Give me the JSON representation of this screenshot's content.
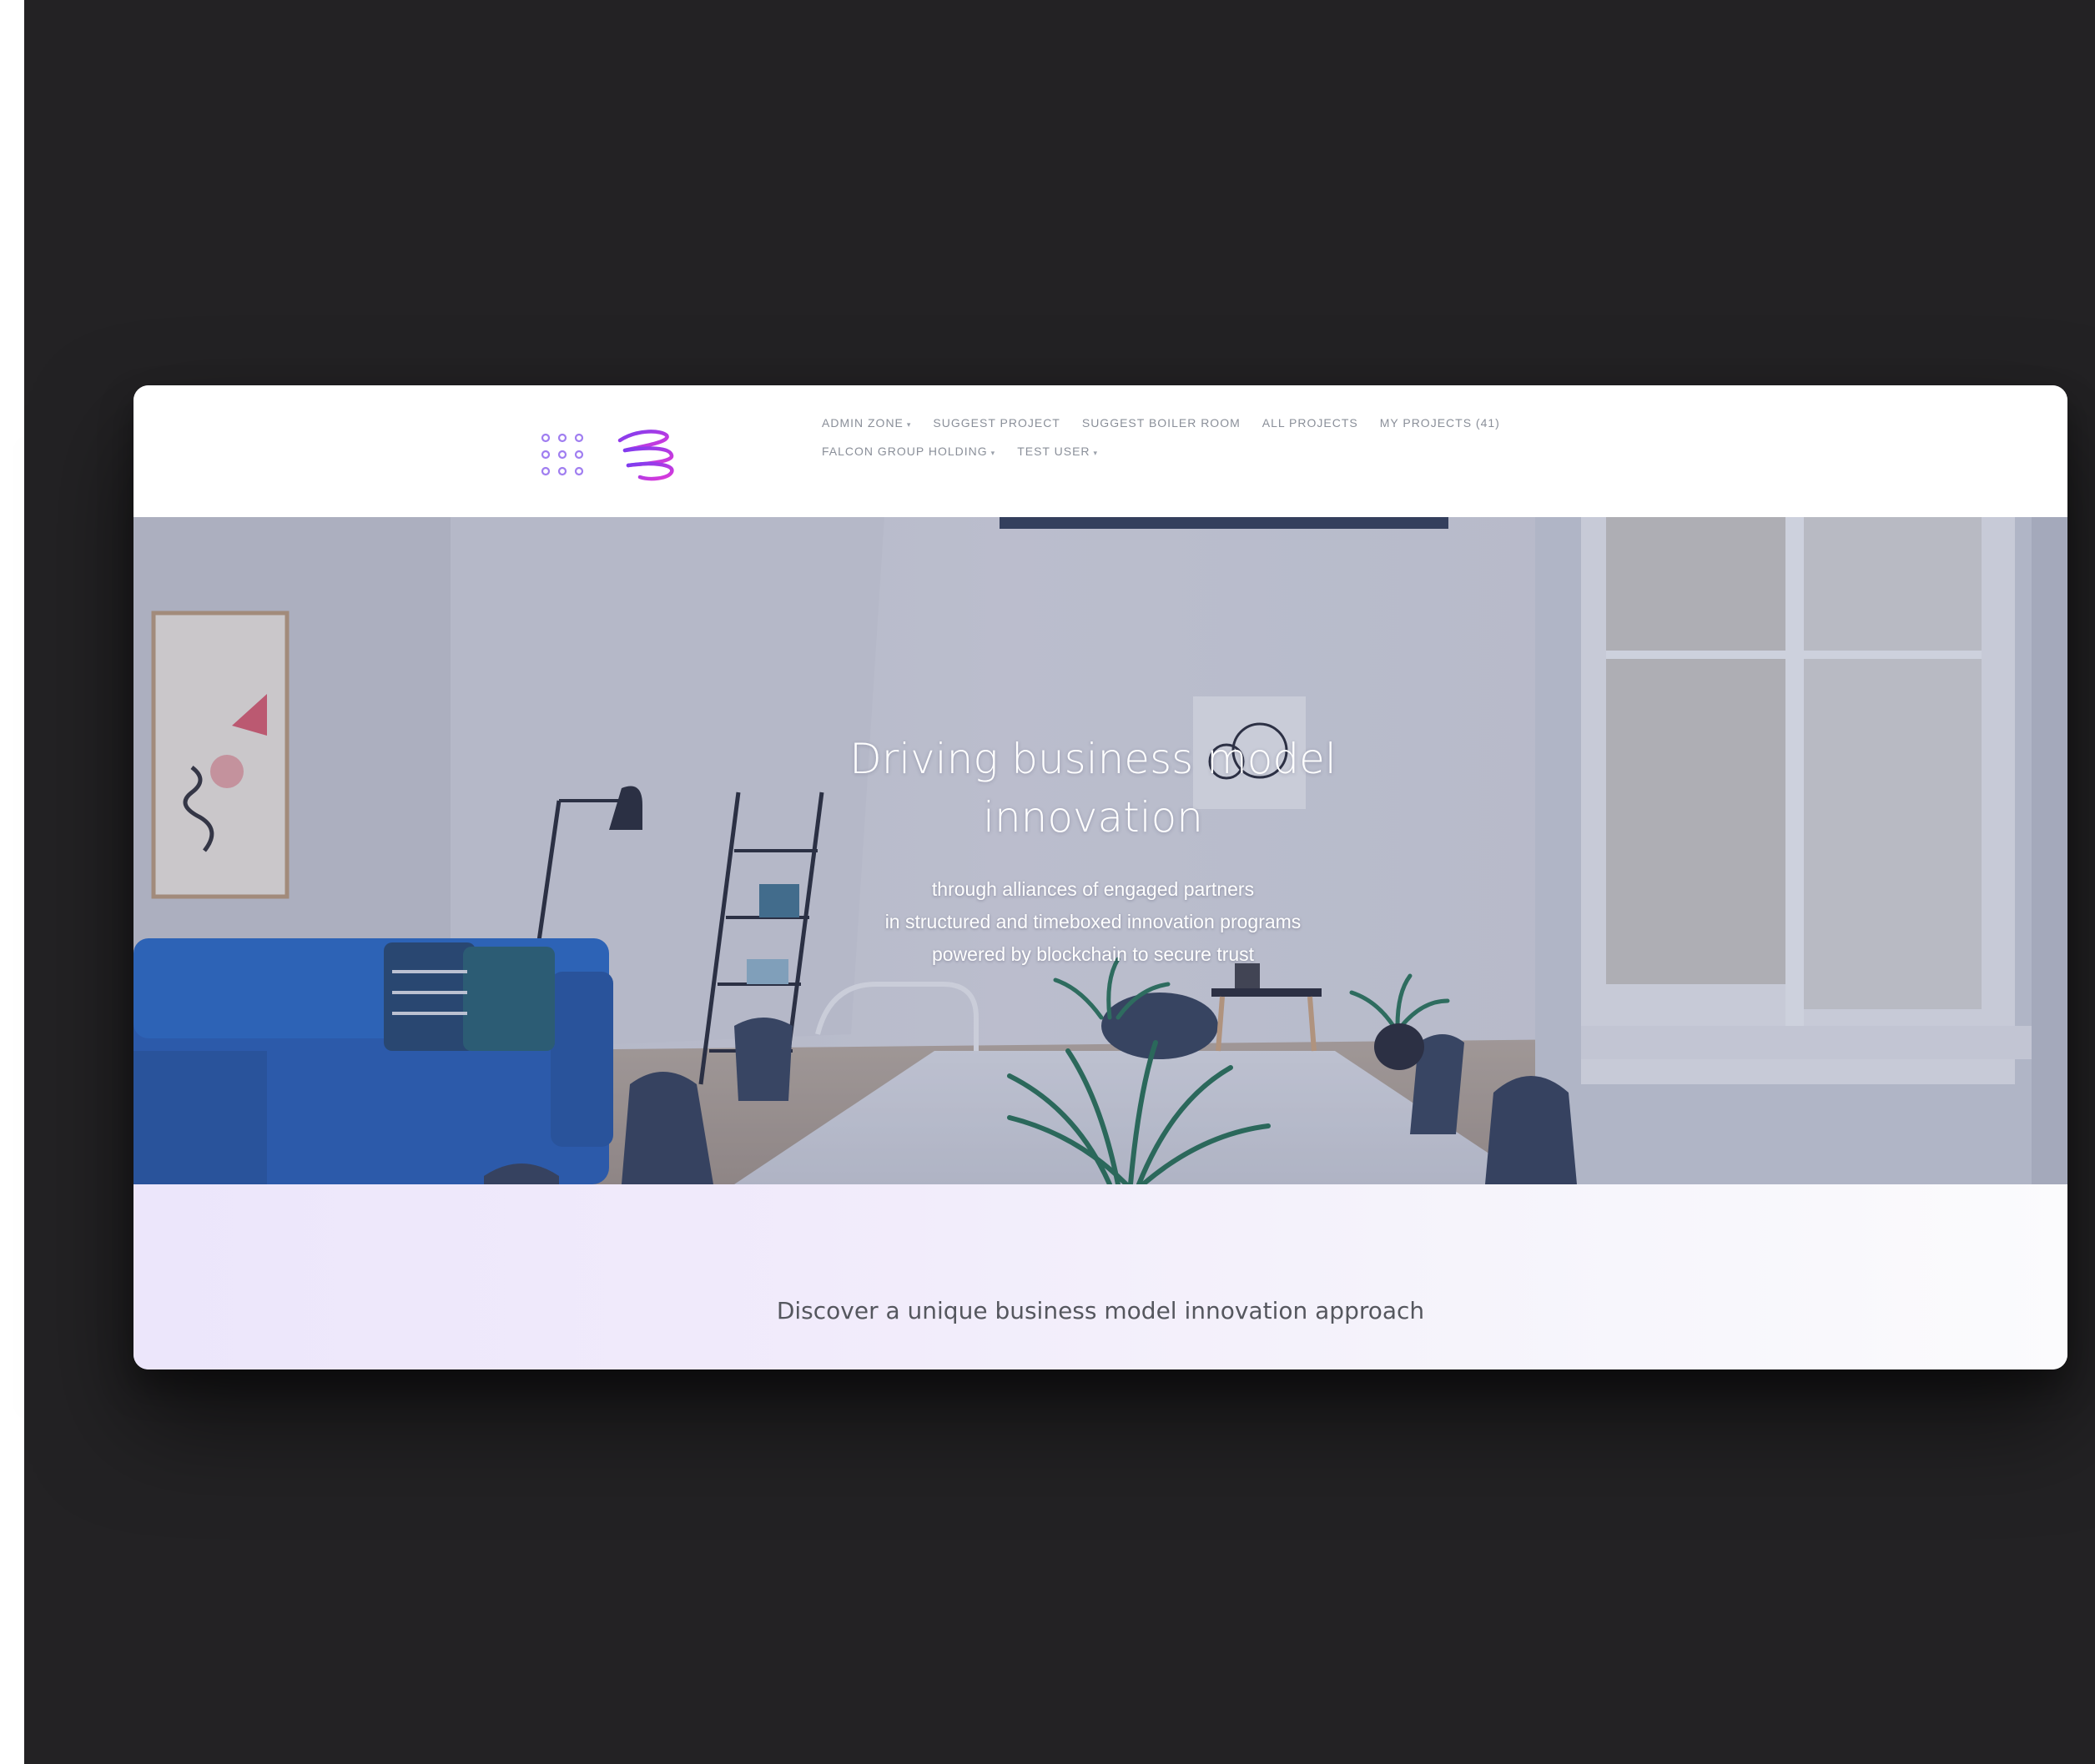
{
  "brand": {
    "dots_logo_icon": "grid-dots-logo-icon",
    "swirl_logo_icon": "swirl-logo-icon",
    "accent_color": "#9b5cf0",
    "swirl_color": "#c23ee8"
  },
  "nav": {
    "row1": [
      {
        "label": "ADMIN ZONE",
        "dropdown": true
      },
      {
        "label": "SUGGEST PROJECT",
        "dropdown": false
      },
      {
        "label": "SUGGEST BOILER ROOM",
        "dropdown": false
      },
      {
        "label": "ALL PROJECTS",
        "dropdown": false
      },
      {
        "label": "MY PROJECTS (41)",
        "dropdown": false
      }
    ],
    "row2": [
      {
        "label": "FALCON GROUP HOLDING",
        "dropdown": true
      },
      {
        "label": "TEST USER",
        "dropdown": true
      }
    ],
    "caret": "▾"
  },
  "hero": {
    "title_line1": "Driving business model",
    "title_line2": "innovation",
    "sub_line1": "through alliances of engaged partners",
    "sub_line2": "in structured and timeboxed innovation programs",
    "sub_line3": "powered by blockchain to secure trust"
  },
  "discover": {
    "text": "Discover a unique business model innovation approach"
  },
  "colors": {
    "backdrop": "#232224",
    "nav_text": "#8a8f99",
    "sofa": "#1f58b3"
  }
}
